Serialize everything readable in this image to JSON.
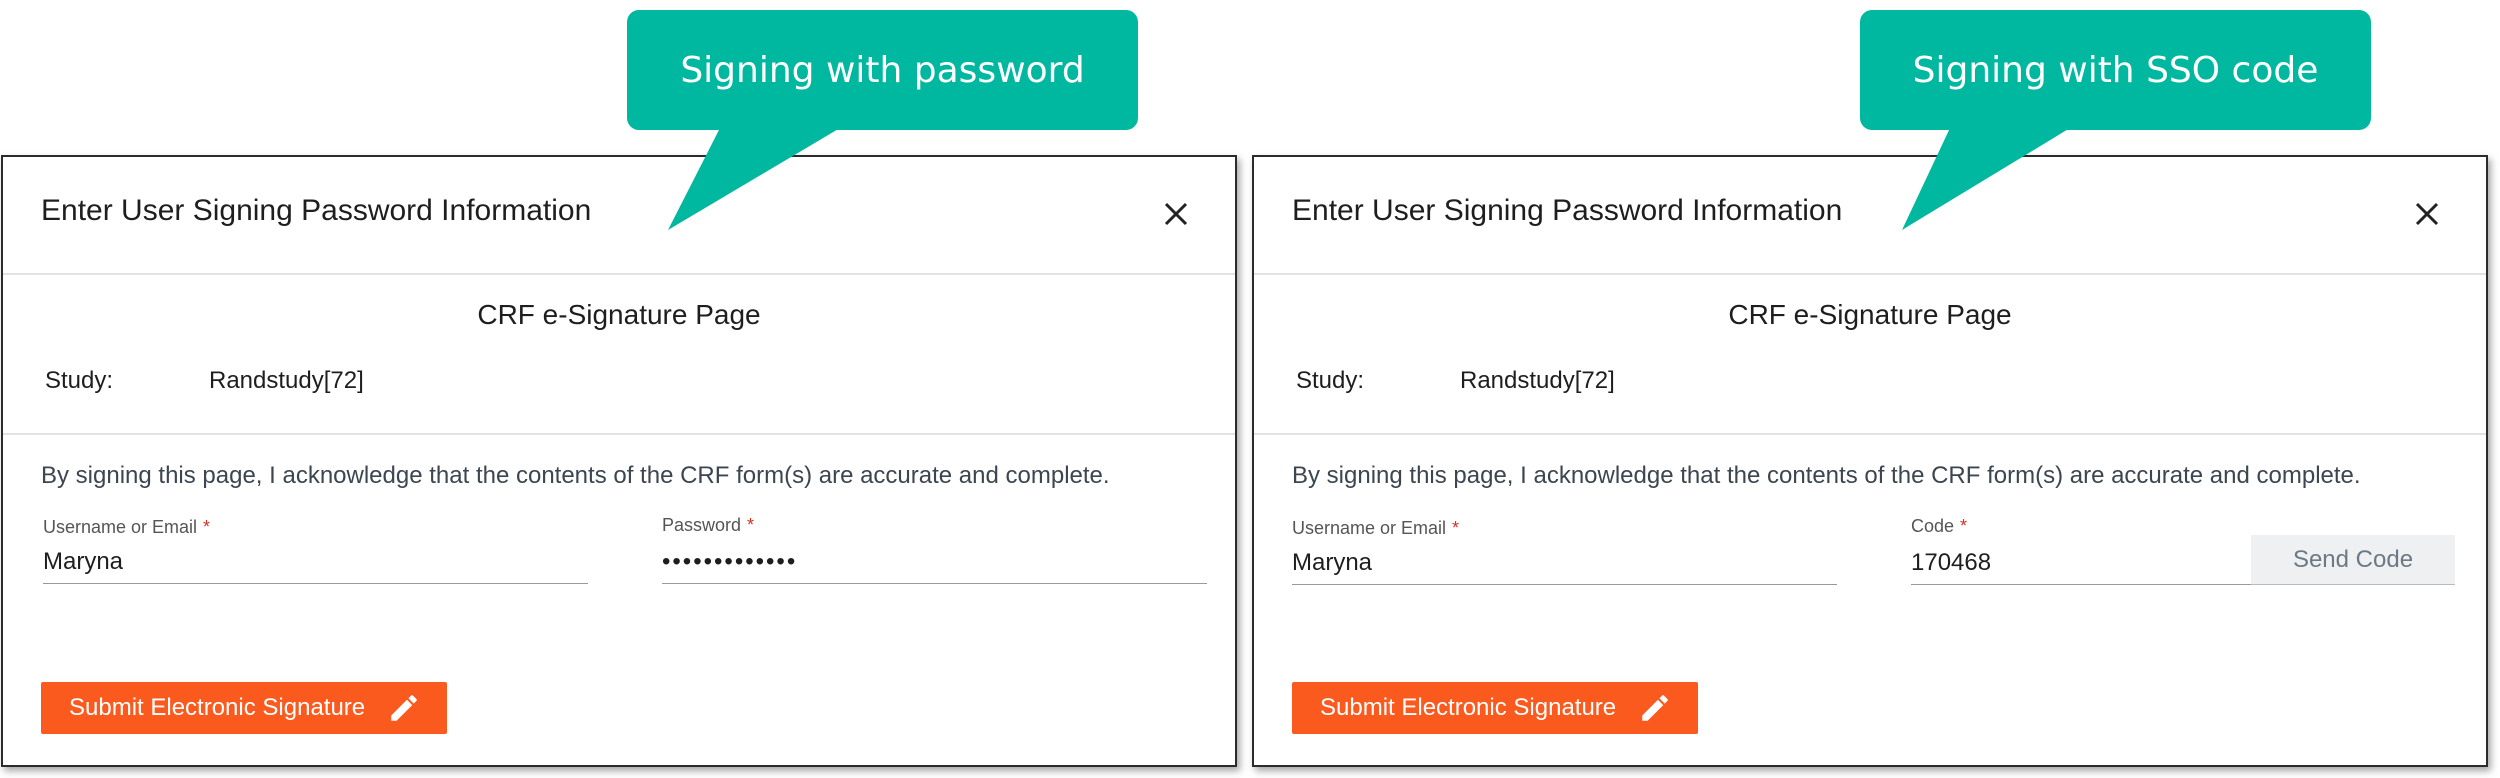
{
  "callouts": [
    {
      "text": "Signing with password"
    },
    {
      "text": "Signing with SSO code"
    }
  ],
  "dialogs": [
    {
      "title": "Enter User Signing Password Information",
      "section_title": "CRF e-Signature Page",
      "study_label": "Study:",
      "study_value": "Randstudy[72]",
      "acknowledgement": "By signing this page, I acknowledge that the contents of the CRF form(s) are accurate and complete.",
      "username_label": "Username or Email",
      "username_value": "Maryna",
      "password_label": "Password",
      "password_value": "•••••••••••••",
      "required_mark": "*",
      "submit_label": "Submit Electronic Signature"
    },
    {
      "title": "Enter User Signing Password Information",
      "section_title": "CRF e-Signature Page",
      "study_label": "Study:",
      "study_value": "Randstudy[72]",
      "acknowledgement": "By signing this page, I acknowledge that the contents of the CRF form(s) are accurate and complete.",
      "username_label": "Username or Email",
      "username_value": "Maryna",
      "code_label": "Code",
      "code_value": "170468",
      "send_code_label": "Send Code",
      "required_mark": "*",
      "submit_label": "Submit Electronic Signature"
    }
  ],
  "colors": {
    "callout": "#00b89f",
    "submit_button": "#fb5a1e",
    "required": "#d93025",
    "send_code_bg": "#eef0f2"
  },
  "icons": {
    "close": "close-icon",
    "submit": "pencil-icon"
  }
}
